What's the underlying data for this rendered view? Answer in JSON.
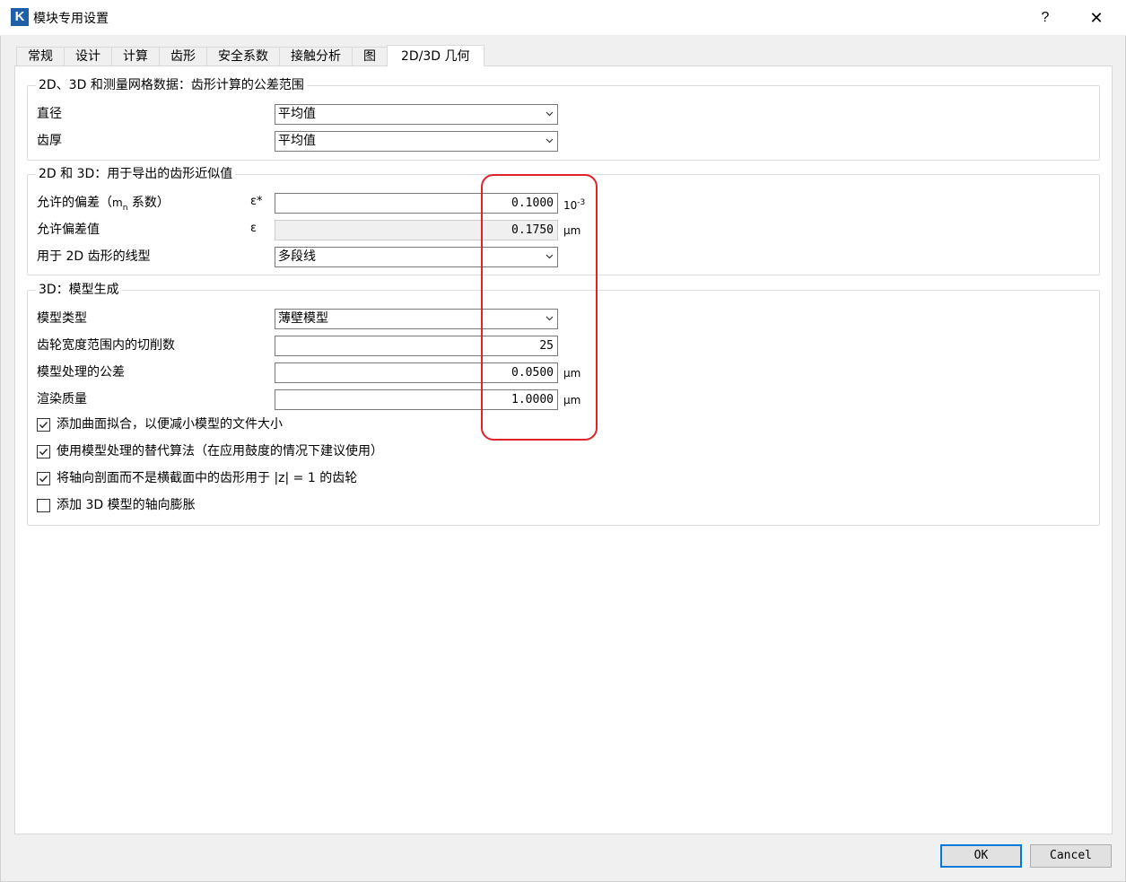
{
  "window": {
    "logo_letter": "K",
    "title": "模块专用设置",
    "help_label": "?",
    "close_label": "✕"
  },
  "tabs": [
    {
      "label": "常规",
      "active": false
    },
    {
      "label": "设计",
      "active": false
    },
    {
      "label": "计算",
      "active": false
    },
    {
      "label": "齿形",
      "active": false
    },
    {
      "label": "安全系数",
      "active": false
    },
    {
      "label": "接触分析",
      "active": false
    },
    {
      "label": "图",
      "active": false
    },
    {
      "label": "2D/3D 几何",
      "active": true
    }
  ],
  "group1": {
    "title": "2D、3D 和测量网格数据：齿形计算的公差范围",
    "diameter_label": "直径",
    "diameter_value": "平均值",
    "thickness_label": "齿厚",
    "thickness_value": "平均值"
  },
  "group2": {
    "title": "2D 和 3D：用于导出的齿形近似值",
    "deviation_label_pre": "允许的偏差（",
    "deviation_label_m": "m",
    "deviation_label_sub": "n",
    "deviation_label_post": " 系数）",
    "deviation_symbol": "ε*",
    "deviation_value": "0.1000",
    "deviation_unit_base": "10",
    "deviation_unit_exp": "-3",
    "deviation_value2_label": "允许偏差值",
    "deviation_value2_symbol": "ε",
    "deviation_value2": "0.1750",
    "deviation_value2_unit": "μm",
    "linetype_label": "用于 2D 齿形的线型",
    "linetype_value": "多段线"
  },
  "group3": {
    "title": "3D：模型生成",
    "model_type_label": "模型类型",
    "model_type_value": "薄壁模型",
    "cuts_label": "齿轮宽度范围内的切削数",
    "cuts_value": "25",
    "tolerance_label": "模型处理的公差",
    "tolerance_value": "0.0500",
    "tolerance_unit": "μm",
    "render_label": "渲染质量",
    "render_value": "1.0000",
    "render_unit": "μm",
    "checkboxes": [
      {
        "label": "添加曲面拟合，以便减小模型的文件大小",
        "checked": true
      },
      {
        "label": "使用模型处理的替代算法（在应用鼓度的情况下建议使用）",
        "checked": true
      },
      {
        "label": "将轴向剖面而不是横截面中的齿形用于 |z| = 1 的齿轮",
        "checked": true
      },
      {
        "label": "添加 3D 模型的轴向膨胀",
        "checked": false
      }
    ]
  },
  "buttons": {
    "ok": "OK",
    "cancel": "Cancel"
  },
  "colors": {
    "highlight": "#e0222b",
    "primary_border": "#0078d7",
    "logo": "#1e5fa8"
  }
}
